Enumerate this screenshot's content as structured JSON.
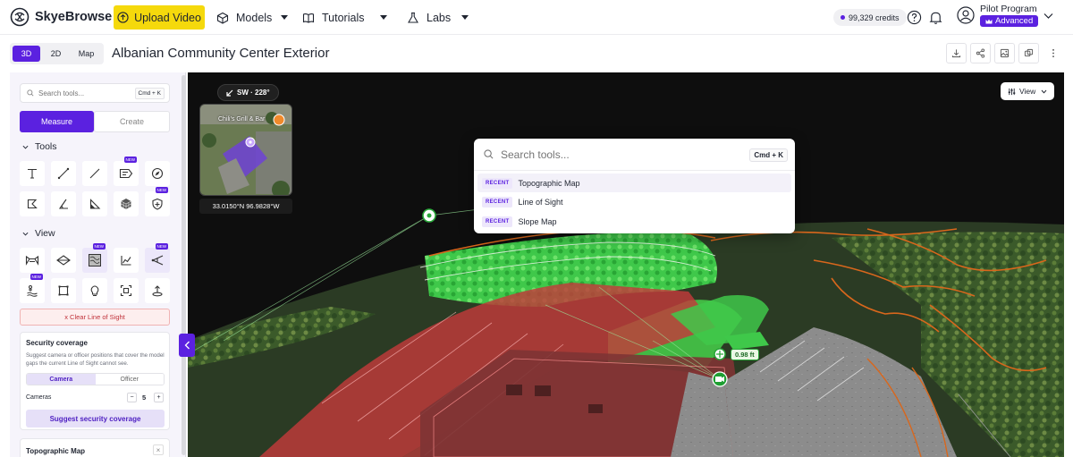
{
  "app": {
    "name": "SkyeBrowse"
  },
  "header": {
    "upload_label": "Upload Video",
    "nav": [
      {
        "label": "Models"
      },
      {
        "label": "Tutorials"
      },
      {
        "label": "Labs"
      }
    ],
    "credits": "99,329 credits",
    "profile_name": "Pilot Program",
    "profile_badge": "Advanced"
  },
  "view_modes": [
    "3D",
    "2D",
    "Map"
  ],
  "active_view_mode": "3D",
  "page_title": "Albanian Community Center Exterior",
  "sidebar": {
    "search_placeholder": "Search tools...",
    "search_shortcut": "Cmd + K",
    "tabs": [
      "Measure",
      "Create"
    ],
    "active_tab": "Measure",
    "tools_heading": "Tools",
    "view_heading": "View",
    "new_badge": "NEW",
    "clear_los": "x   Clear Line of Sight",
    "security": {
      "title": "Security coverage",
      "description": "Suggest camera or officer positions that cover the model gaps the current Line of Sight cannot see.",
      "modes": [
        "Camera",
        "Officer"
      ],
      "active_mode": "Camera",
      "cameras_label": "Cameras",
      "cameras_value": "5",
      "minus": "−",
      "plus": "+",
      "suggest_label": "Suggest security coverage"
    },
    "topo_card": {
      "title": "Topographic Map",
      "close": "×"
    }
  },
  "viewport": {
    "compass": "SW · 228°",
    "minimap_label": "Chili's Grill & Bar",
    "coords": "33.0150°N 96.9828°W",
    "view_button": "View",
    "measurement": "0.98 ft"
  },
  "palette": {
    "placeholder": "Search tools...",
    "shortcut": "Cmd + K",
    "tag": "RECENT",
    "items": [
      {
        "label": "Topographic Map"
      },
      {
        "label": "Line of Sight"
      },
      {
        "label": "Slope Map"
      }
    ]
  },
  "colors": {
    "accent": "#5b21e0",
    "upload": "#f5d90c",
    "los_green": "#3fcf4a",
    "los_red": "#d93b3b",
    "contour": "#d9671c"
  }
}
